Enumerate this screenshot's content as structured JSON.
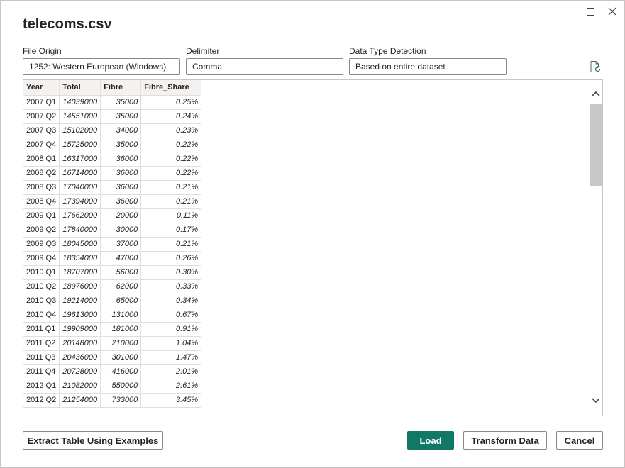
{
  "window": {
    "title": "telecoms.csv"
  },
  "options": {
    "file_origin": {
      "label": "File Origin",
      "value": "1252: Western European (Windows)"
    },
    "delimiter": {
      "label": "Delimiter",
      "value": "Comma"
    },
    "data_type_detection": {
      "label": "Data Type Detection",
      "value": "Based on entire dataset"
    }
  },
  "table": {
    "columns": [
      "Year",
      "Total",
      "Fibre",
      "Fibre_Share"
    ],
    "rows": [
      [
        "2007 Q1",
        "14039000",
        "35000",
        "0.25%"
      ],
      [
        "2007 Q2",
        "14551000",
        "35000",
        "0.24%"
      ],
      [
        "2007 Q3",
        "15102000",
        "34000",
        "0.23%"
      ],
      [
        "2007 Q4",
        "15725000",
        "35000",
        "0.22%"
      ],
      [
        "2008 Q1",
        "16317000",
        "36000",
        "0.22%"
      ],
      [
        "2008 Q2",
        "16714000",
        "36000",
        "0.22%"
      ],
      [
        "2008 Q3",
        "17040000",
        "36000",
        "0.21%"
      ],
      [
        "2008 Q4",
        "17394000",
        "36000",
        "0.21%"
      ],
      [
        "2009 Q1",
        "17662000",
        "20000",
        "0.11%"
      ],
      [
        "2009 Q2",
        "17840000",
        "30000",
        "0.17%"
      ],
      [
        "2009 Q3",
        "18045000",
        "37000",
        "0.21%"
      ],
      [
        "2009 Q4",
        "18354000",
        "47000",
        "0.26%"
      ],
      [
        "2010 Q1",
        "18707000",
        "56000",
        "0.30%"
      ],
      [
        "2010 Q2",
        "18976000",
        "62000",
        "0.33%"
      ],
      [
        "2010 Q3",
        "19214000",
        "65000",
        "0.34%"
      ],
      [
        "2010 Q4",
        "19613000",
        "131000",
        "0.67%"
      ],
      [
        "2011 Q1",
        "19909000",
        "181000",
        "0.91%"
      ],
      [
        "2011 Q2",
        "20148000",
        "210000",
        "1.04%"
      ],
      [
        "2011 Q3",
        "20436000",
        "301000",
        "1.47%"
      ],
      [
        "2011 Q4",
        "20728000",
        "416000",
        "2.01%"
      ],
      [
        "2012 Q1",
        "21082000",
        "550000",
        "2.61%"
      ],
      [
        "2012 Q2",
        "21254000",
        "733000",
        "3.45%"
      ]
    ]
  },
  "buttons": {
    "extract": "Extract Table Using Examples",
    "load": "Load",
    "transform": "Transform Data",
    "cancel": "Cancel"
  },
  "icons": {
    "maximize": "maximize-icon",
    "close": "close-icon",
    "refresh": "refresh-document-icon",
    "dropdown": "chevron-down-icon"
  },
  "colors": {
    "primary": "#117865",
    "scroll_thumb": "#c8c8c8",
    "header_bg": "#f3f2f1"
  }
}
